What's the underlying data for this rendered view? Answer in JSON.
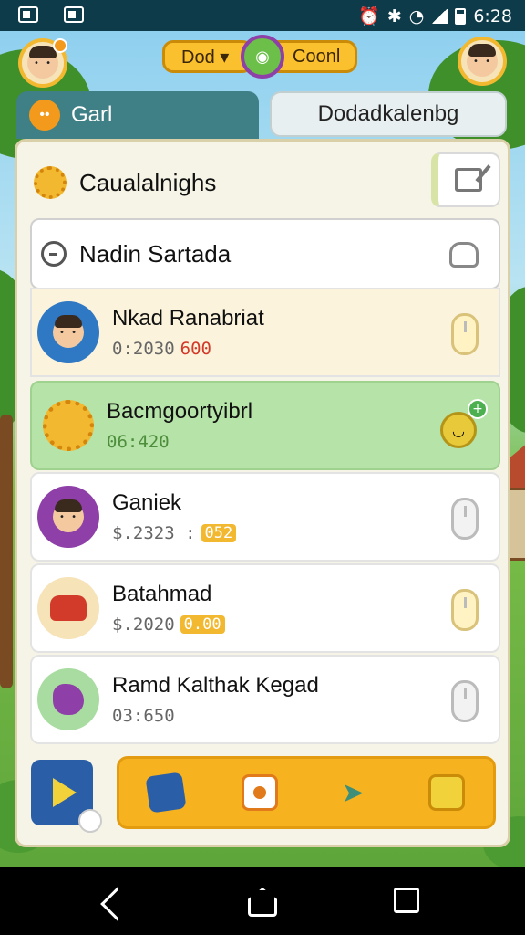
{
  "status_bar": {
    "time": "6:28"
  },
  "top_bar": {
    "left_pill": "Dod ▾",
    "right_pill": "Coonl"
  },
  "tabs": [
    {
      "label": "Garl",
      "active": true
    },
    {
      "label": "Dodadkalenbg",
      "active": false
    }
  ],
  "panel": {
    "title": "Caualalnighs",
    "search_value": "Nadin Sartada"
  },
  "rows": [
    {
      "name": "Nkad Ranabriat",
      "meta": "0:2030",
      "badge": "600",
      "badge_style": "alert",
      "avatar_icon": "person-avatar-icon",
      "avatar_bg": "#2f78c4"
    },
    {
      "name": "Bacmgoortyibrl",
      "meta": "06:420",
      "badge": "",
      "badge_style": "green",
      "avatar_icon": "sun-avatar-icon",
      "avatar_bg": "#b5e3a8"
    },
    {
      "name": "Ganiek",
      "meta": "$.2323 :",
      "badge": "052",
      "badge_style": "box",
      "avatar_icon": "person-avatar-icon",
      "avatar_bg": "#8e3fa8"
    },
    {
      "name": "Batahmad",
      "meta": "$.2020",
      "badge": "0.00",
      "badge_style": "box",
      "avatar_icon": "creature-avatar-icon",
      "avatar_bg": "#f6e3b8"
    },
    {
      "name": "Ramd Kalthak Kegad",
      "meta": "03:650",
      "badge": "",
      "badge_style": "none",
      "avatar_icon": "candy-avatar-icon",
      "avatar_bg": "#a8dca0"
    }
  ],
  "dock": {
    "items": [
      "cube-icon",
      "camera-icon",
      "plane-icon",
      "wallet-icon"
    ]
  },
  "colors": {
    "accent": "#f6b21f",
    "tab_active": "#3f7f86",
    "highlight_row": "#b5e3a8",
    "alert": "#d23a2a"
  }
}
